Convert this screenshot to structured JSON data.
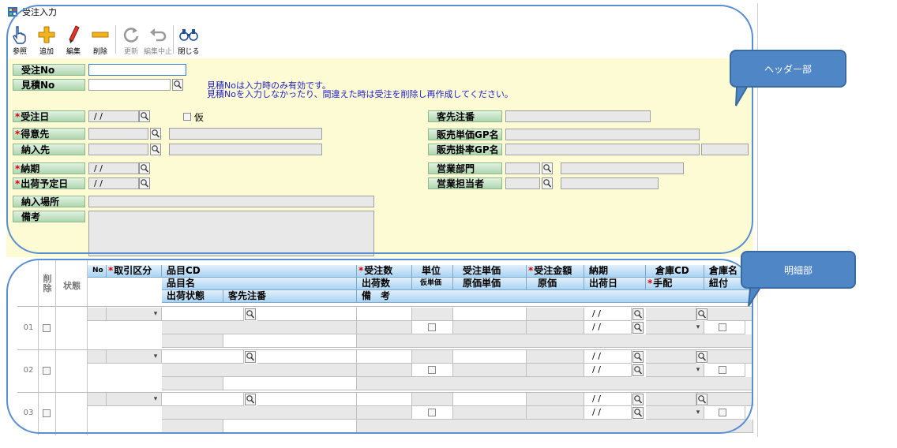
{
  "window": {
    "title": "受注入力"
  },
  "toolbar": {
    "buttons": [
      {
        "label": "参照",
        "icon": "pointer-hand-icon",
        "enabled": true
      },
      {
        "label": "追加",
        "icon": "plus-icon",
        "enabled": true
      },
      {
        "label": "編集",
        "icon": "pencil-icon",
        "enabled": true
      },
      {
        "label": "削除",
        "icon": "minus-icon",
        "enabled": true
      },
      {
        "label": "更新",
        "icon": "refresh-icon",
        "enabled": false
      },
      {
        "label": "編集中止",
        "icon": "undo-icon",
        "enabled": false
      },
      {
        "label": "閉じる",
        "icon": "binoculars-icon",
        "enabled": true
      }
    ]
  },
  "header": {
    "juchu_no_label": "受注No",
    "mitsumori_no_label": "見積No",
    "note_line1": "見積Noは入力時のみ有効です。",
    "note_line2": "見積Noを入力しなかったり、間違えた時は受注を削除し再作成してください。",
    "juchubi_label": "受注日",
    "date_placeholder": "/ /",
    "kari_label": "仮",
    "tokuisaki_label": "得意先",
    "nonyusaki_label": "納入先",
    "noki_label": "納期",
    "shukka_yotei_label": "出荷予定日",
    "nonyu_basho_label": "納入場所",
    "biko_label": "備考",
    "kyakusaki_chuban_label": "客先注番",
    "hanbai_tanka_gp_label": "販売単価GP名",
    "hanbai_kakeritsu_gp_label": "販売掛率GP名",
    "eigyo_bumon_label": "営業部門",
    "eigyo_tanto_label": "営業担当者",
    "required_mark": "*"
  },
  "grid": {
    "col_delete": "削除",
    "col_status": "状態",
    "col_no": "No",
    "col_torihiki_kubun": "取引区分",
    "col_hinmoku_cd": "品目CD",
    "col_hinmoku_mei": "品目名",
    "col_shukka_jotai": "出荷状態",
    "col_kyakusaki_chuban": "客先注番",
    "col_juchu_su": "受注数",
    "col_shukka_su": "出荷数",
    "col_biko": "備　考",
    "col_tani": "単位",
    "col_kari_tanka": "仮単価",
    "col_juchu_tanka": "受注単価",
    "col_genka_tanka": "原価単価",
    "col_juchu_kingaku": "受注金額",
    "col_genka": "原価",
    "col_noki": "納期",
    "col_shukkabi": "出荷日",
    "col_soko_cd": "倉庫CD",
    "col_tehai": "手配",
    "col_soko_mei": "倉庫名",
    "col_himozuke": "紐付",
    "rows": [
      {
        "no": "01"
      },
      {
        "no": "02"
      },
      {
        "no": "03"
      }
    ]
  },
  "callouts": {
    "header": "ヘッダー部",
    "detail": "明細部"
  },
  "colors": {
    "header_bg": "#fdfbd4",
    "label_green": "#aed6ae",
    "grid_head_blue": "#a9d3f2",
    "callout_blue": "#4f86c6",
    "required_red": "#e00000"
  }
}
